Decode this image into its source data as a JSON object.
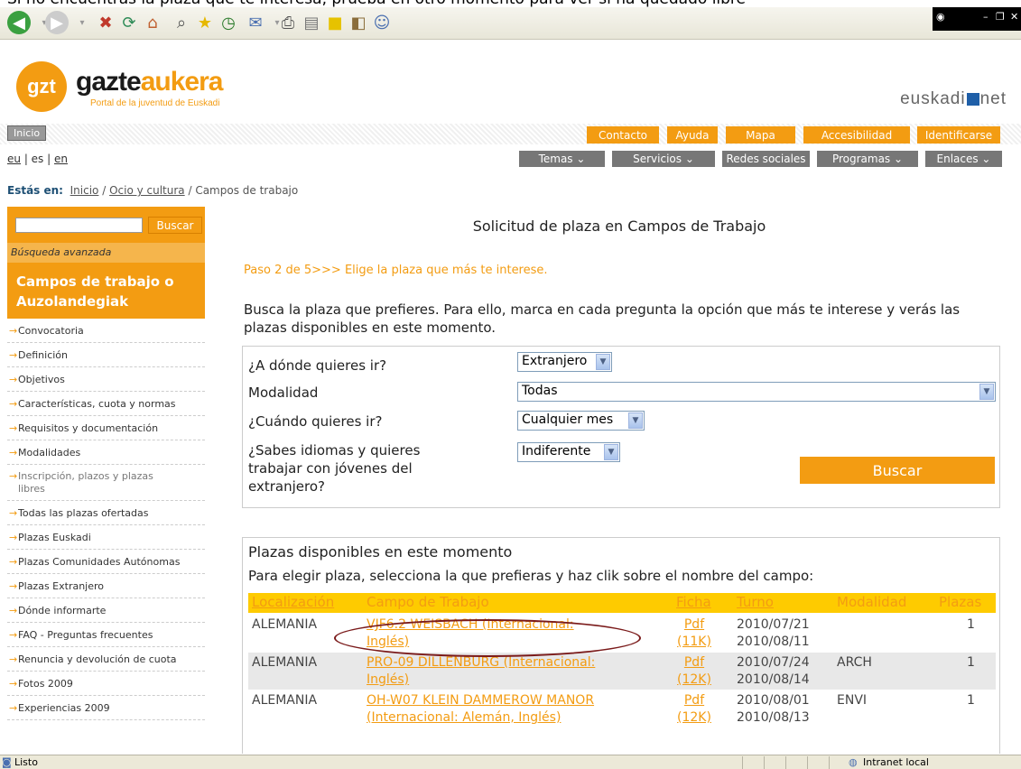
{
  "top_message": "Si no encuentras la plaza que te interesa, prueba en otro momento para ver si ha quedado libre",
  "header": {
    "logo_initials": "gzt",
    "logo_name_a": "gazte",
    "logo_name_b": "aukera",
    "logo_subtitle": "Portal de la juventud de Euskadi",
    "brand_left": "euskadi",
    "brand_right": "net"
  },
  "top_nav": {
    "inicio": "Inicio",
    "items": [
      "Contacto",
      "Ayuda",
      "Mapa",
      "Accesibilidad",
      "Identificarse"
    ]
  },
  "languages": [
    "eu",
    "es",
    "en"
  ],
  "main_nav": [
    "Temas ⌄",
    "Servicios ⌄",
    "Redes sociales",
    "Programas ⌄",
    "Enlaces ⌄"
  ],
  "breadcrumb": {
    "label": "Estás en:",
    "items": [
      "Inicio",
      "Ocio y cultura",
      "Campos de trabajo"
    ]
  },
  "sidebar": {
    "search_button": "Buscar",
    "advanced": "Búsqueda avanzada",
    "title_l1": "Campos de trabajo o",
    "title_l2": "Auzolandegiak",
    "items": [
      "Convocatoria",
      "Definición",
      "Objetivos",
      "Características, cuota y normas",
      "Requisitos y documentación",
      "Modalidades",
      "Inscripción, plazos y plazas libres",
      "Todas las plazas ofertadas",
      "Plazas Euskadi",
      "Plazas Comunidades Autónomas",
      "Plazas Extranjero",
      "Dónde informarte",
      "FAQ - Preguntas frecuentes",
      "Renuncia y devolución de cuota",
      "Fotos 2009",
      "Experiencias 2009"
    ]
  },
  "main": {
    "title": "Solicitud de plaza en Campos de Trabajo",
    "step": "Paso 2 de 5>>> Elige la plaza que más te interese.",
    "intro": "Busca la plaza que prefieres. Para ello, marca en cada pregunta la opción que más te interese y verás las plazas disponibles en este momento.",
    "q1": "¿A dónde quieres ir?",
    "q1_value": "Extranjero",
    "q2": "Modalidad",
    "q2_value": "Todas",
    "q3": "¿Cuándo quieres ir?",
    "q3_value": "Cualquier mes",
    "q4_l1": "¿Sabes idiomas y quieres",
    "q4_l2": "trabajar con jóvenes del",
    "q4_l3": "extranjero?",
    "q4_value": "Indiferente",
    "search_button": "Buscar"
  },
  "results": {
    "title": "Plazas disponibles en este momento",
    "subtitle": "Para elegir plaza, selecciona la que prefieras y haz clik sobre el nombre del campo:",
    "columns": [
      "Localización",
      "Campo de Trabajo",
      "Ficha",
      "Turno",
      "Modalidad",
      "Plazas"
    ],
    "rows": [
      {
        "loc": "ALEMANIA",
        "camp_l1": "VJF6.2 WEISBACH (Internacional:",
        "camp_l2": "Inglés)",
        "ficha_l1": "Pdf",
        "ficha_l2": "(11K)",
        "turno_l1": "2010/07/21",
        "turno_l2": "2010/08/11",
        "modalidad": "",
        "plazas": "1"
      },
      {
        "loc": "ALEMANIA",
        "camp_l1": "PRO-09 DILLENBURG (Internacional:",
        "camp_l2": "Inglés)",
        "ficha_l1": "Pdf",
        "ficha_l2": "(12K)",
        "turno_l1": "2010/07/24",
        "turno_l2": "2010/08/14",
        "modalidad": "ARCH",
        "plazas": "1"
      },
      {
        "loc": "ALEMANIA",
        "camp_l1": "OH-W07 KLEIN DAMMEROW MANOR",
        "camp_l2": "(Internacional: Alemán, Inglés)",
        "ficha_l1": "Pdf",
        "ficha_l2": "(12K)",
        "turno_l1": "2010/08/01",
        "turno_l2": "2010/08/13",
        "modalidad": "ENVI",
        "plazas": "1"
      }
    ]
  },
  "status": {
    "text": "Listo",
    "zone": "Intranet local"
  }
}
